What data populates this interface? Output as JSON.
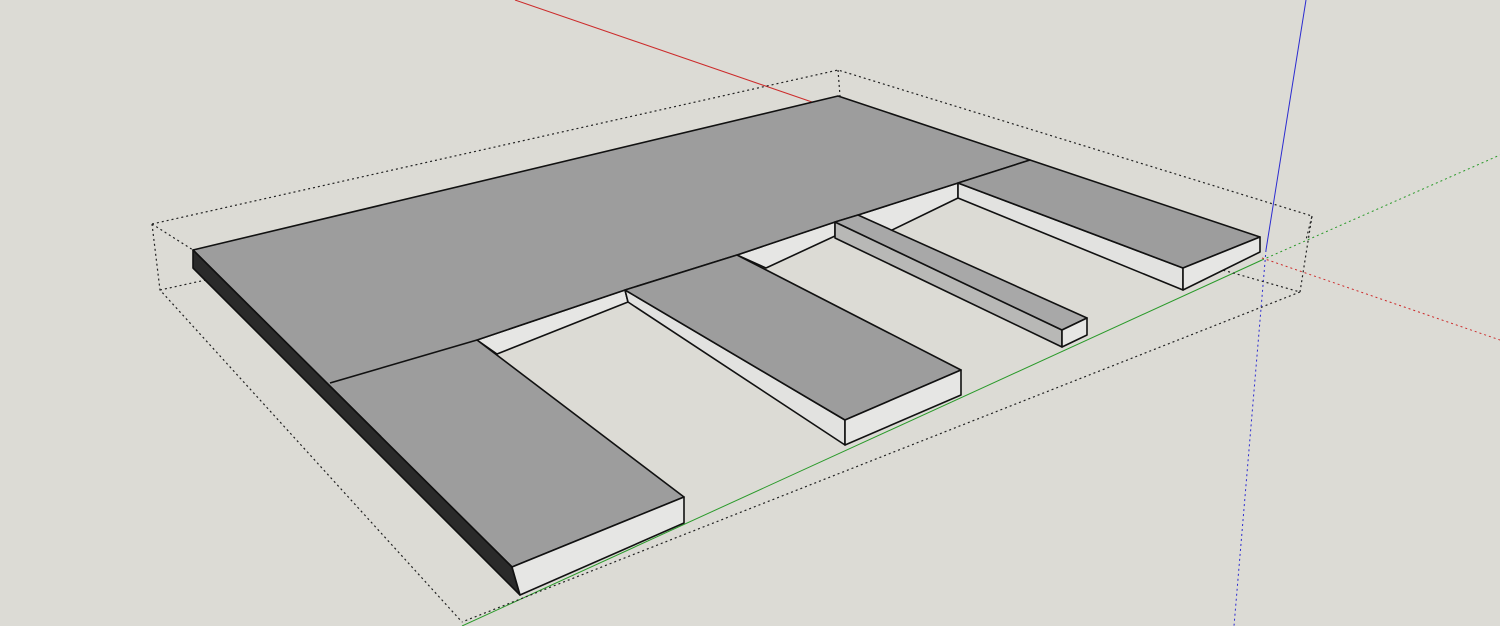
{
  "viewport": {
    "background": "#dcdbd5",
    "colors": {
      "top_face": "#9d9d9d",
      "side_face": "#e4e4e2",
      "dark_side": "#2a2a2a",
      "x_axis": "#cc2b2b",
      "y_axis": "#2a9a2a",
      "z_axis": "#2b2bd0"
    }
  }
}
